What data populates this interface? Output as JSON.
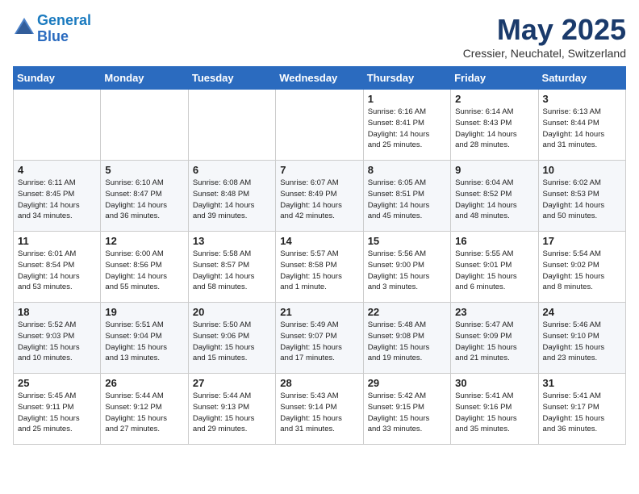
{
  "logo": {
    "line1": "General",
    "line2": "Blue"
  },
  "title": "May 2025",
  "location": "Cressier, Neuchatel, Switzerland",
  "weekdays": [
    "Sunday",
    "Monday",
    "Tuesday",
    "Wednesday",
    "Thursday",
    "Friday",
    "Saturday"
  ],
  "weeks": [
    [
      {
        "day": "",
        "info": ""
      },
      {
        "day": "",
        "info": ""
      },
      {
        "day": "",
        "info": ""
      },
      {
        "day": "",
        "info": ""
      },
      {
        "day": "1",
        "info": "Sunrise: 6:16 AM\nSunset: 8:41 PM\nDaylight: 14 hours\nand 25 minutes."
      },
      {
        "day": "2",
        "info": "Sunrise: 6:14 AM\nSunset: 8:43 PM\nDaylight: 14 hours\nand 28 minutes."
      },
      {
        "day": "3",
        "info": "Sunrise: 6:13 AM\nSunset: 8:44 PM\nDaylight: 14 hours\nand 31 minutes."
      }
    ],
    [
      {
        "day": "4",
        "info": "Sunrise: 6:11 AM\nSunset: 8:45 PM\nDaylight: 14 hours\nand 34 minutes."
      },
      {
        "day": "5",
        "info": "Sunrise: 6:10 AM\nSunset: 8:47 PM\nDaylight: 14 hours\nand 36 minutes."
      },
      {
        "day": "6",
        "info": "Sunrise: 6:08 AM\nSunset: 8:48 PM\nDaylight: 14 hours\nand 39 minutes."
      },
      {
        "day": "7",
        "info": "Sunrise: 6:07 AM\nSunset: 8:49 PM\nDaylight: 14 hours\nand 42 minutes."
      },
      {
        "day": "8",
        "info": "Sunrise: 6:05 AM\nSunset: 8:51 PM\nDaylight: 14 hours\nand 45 minutes."
      },
      {
        "day": "9",
        "info": "Sunrise: 6:04 AM\nSunset: 8:52 PM\nDaylight: 14 hours\nand 48 minutes."
      },
      {
        "day": "10",
        "info": "Sunrise: 6:02 AM\nSunset: 8:53 PM\nDaylight: 14 hours\nand 50 minutes."
      }
    ],
    [
      {
        "day": "11",
        "info": "Sunrise: 6:01 AM\nSunset: 8:54 PM\nDaylight: 14 hours\nand 53 minutes."
      },
      {
        "day": "12",
        "info": "Sunrise: 6:00 AM\nSunset: 8:56 PM\nDaylight: 14 hours\nand 55 minutes."
      },
      {
        "day": "13",
        "info": "Sunrise: 5:58 AM\nSunset: 8:57 PM\nDaylight: 14 hours\nand 58 minutes."
      },
      {
        "day": "14",
        "info": "Sunrise: 5:57 AM\nSunset: 8:58 PM\nDaylight: 15 hours\nand 1 minute."
      },
      {
        "day": "15",
        "info": "Sunrise: 5:56 AM\nSunset: 9:00 PM\nDaylight: 15 hours\nand 3 minutes."
      },
      {
        "day": "16",
        "info": "Sunrise: 5:55 AM\nSunset: 9:01 PM\nDaylight: 15 hours\nand 6 minutes."
      },
      {
        "day": "17",
        "info": "Sunrise: 5:54 AM\nSunset: 9:02 PM\nDaylight: 15 hours\nand 8 minutes."
      }
    ],
    [
      {
        "day": "18",
        "info": "Sunrise: 5:52 AM\nSunset: 9:03 PM\nDaylight: 15 hours\nand 10 minutes."
      },
      {
        "day": "19",
        "info": "Sunrise: 5:51 AM\nSunset: 9:04 PM\nDaylight: 15 hours\nand 13 minutes."
      },
      {
        "day": "20",
        "info": "Sunrise: 5:50 AM\nSunset: 9:06 PM\nDaylight: 15 hours\nand 15 minutes."
      },
      {
        "day": "21",
        "info": "Sunrise: 5:49 AM\nSunset: 9:07 PM\nDaylight: 15 hours\nand 17 minutes."
      },
      {
        "day": "22",
        "info": "Sunrise: 5:48 AM\nSunset: 9:08 PM\nDaylight: 15 hours\nand 19 minutes."
      },
      {
        "day": "23",
        "info": "Sunrise: 5:47 AM\nSunset: 9:09 PM\nDaylight: 15 hours\nand 21 minutes."
      },
      {
        "day": "24",
        "info": "Sunrise: 5:46 AM\nSunset: 9:10 PM\nDaylight: 15 hours\nand 23 minutes."
      }
    ],
    [
      {
        "day": "25",
        "info": "Sunrise: 5:45 AM\nSunset: 9:11 PM\nDaylight: 15 hours\nand 25 minutes."
      },
      {
        "day": "26",
        "info": "Sunrise: 5:44 AM\nSunset: 9:12 PM\nDaylight: 15 hours\nand 27 minutes."
      },
      {
        "day": "27",
        "info": "Sunrise: 5:44 AM\nSunset: 9:13 PM\nDaylight: 15 hours\nand 29 minutes."
      },
      {
        "day": "28",
        "info": "Sunrise: 5:43 AM\nSunset: 9:14 PM\nDaylight: 15 hours\nand 31 minutes."
      },
      {
        "day": "29",
        "info": "Sunrise: 5:42 AM\nSunset: 9:15 PM\nDaylight: 15 hours\nand 33 minutes."
      },
      {
        "day": "30",
        "info": "Sunrise: 5:41 AM\nSunset: 9:16 PM\nDaylight: 15 hours\nand 35 minutes."
      },
      {
        "day": "31",
        "info": "Sunrise: 5:41 AM\nSunset: 9:17 PM\nDaylight: 15 hours\nand 36 minutes."
      }
    ]
  ]
}
